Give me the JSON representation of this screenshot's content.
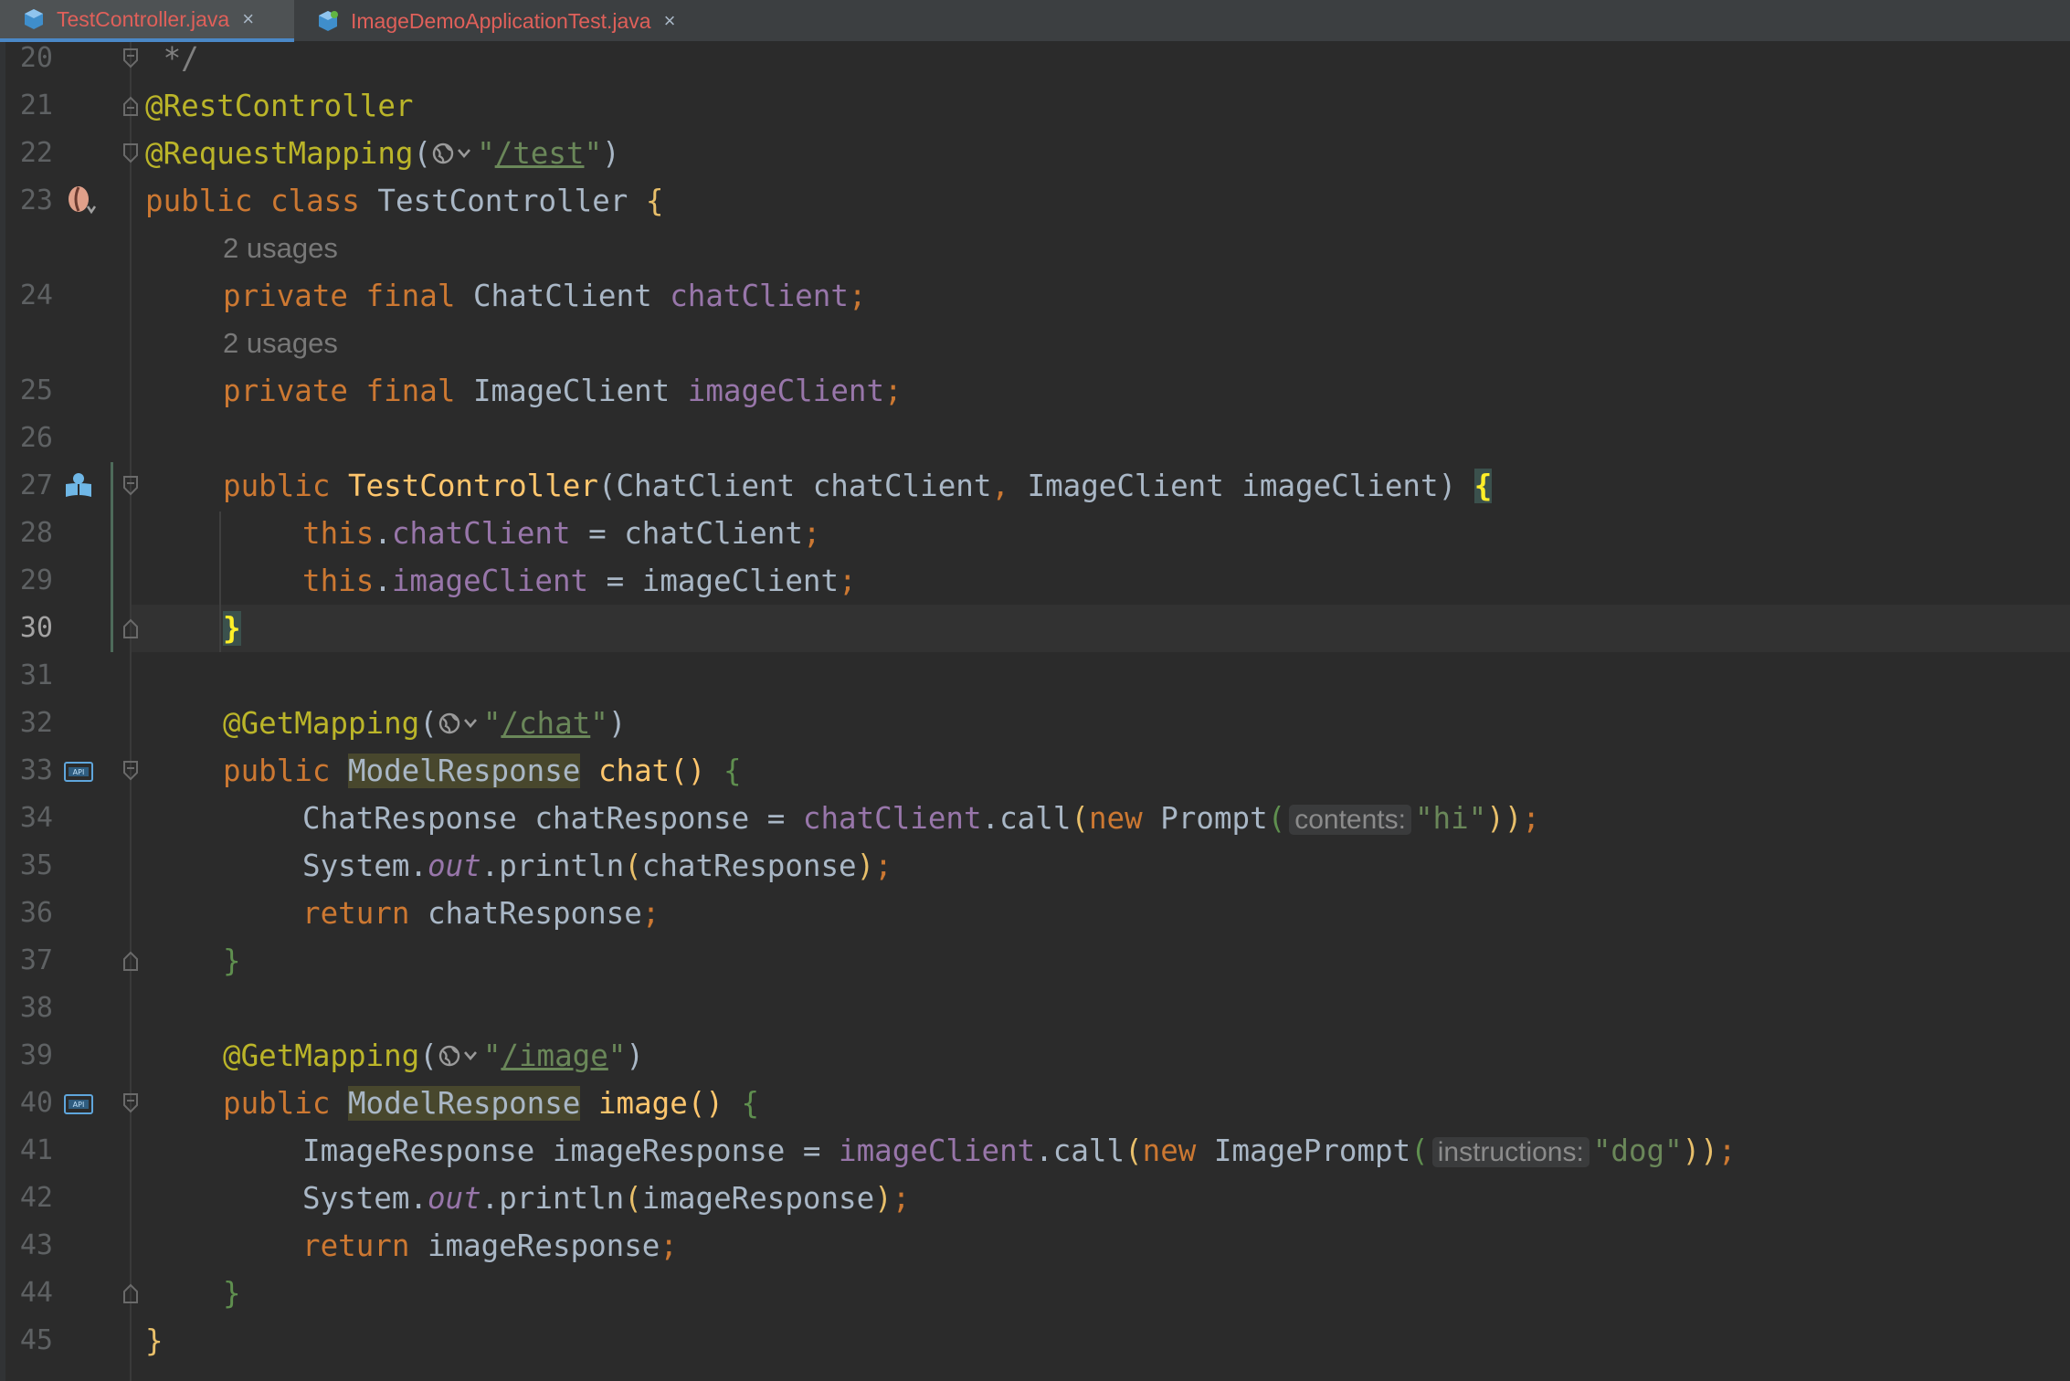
{
  "tabs": [
    {
      "label": "TestController.java",
      "active": true
    },
    {
      "label": "ImageDemoApplicationTest.java",
      "active": false
    }
  ],
  "tab_close_glyph": "×",
  "colors": {
    "background": "#2b2b2b",
    "keyword": "#cc7832",
    "annotation": "#bbb529",
    "field": "#9876aa",
    "string": "#6a8759",
    "method": "#ffc66d",
    "tab_text": "#e0605a"
  },
  "current_line": "30",
  "editor": {
    "l20": {
      "num": "20",
      "c": " */"
    },
    "l21": {
      "num": "21",
      "ann": "@RestController"
    },
    "l22": {
      "num": "22",
      "ann": "@RequestMapping",
      "p1": "(",
      "q": "\"",
      "url": "/test",
      "p2": ")"
    },
    "l23": {
      "num": "23",
      "k1": "public",
      "k2": "class",
      "name": "TestController",
      "b": "{"
    },
    "h1": "2 usages",
    "l24": {
      "num": "24",
      "k1": "private",
      "k2": "final",
      "type": "ChatClient",
      "f": "chatClient",
      "s": ";"
    },
    "h2": "2 usages",
    "l25": {
      "num": "25",
      "k1": "private",
      "k2": "final",
      "type": "ImageClient",
      "f": "imageClient",
      "s": ";"
    },
    "l26": {
      "num": "26"
    },
    "l27": {
      "num": "27",
      "k1": "public",
      "m": "TestController",
      "a": "(ChatClient chatClient",
      "comma": ",",
      "b": " ImageClient imageClient)",
      "br": "{"
    },
    "l28": {
      "num": "28",
      "k": "this",
      "dot": ".",
      "f": "chatClient",
      "rest": " = chatClient",
      "s": ";"
    },
    "l29": {
      "num": "29",
      "k": "this",
      "dot": ".",
      "f": "imageClient",
      "rest": " = imageClient",
      "s": ";"
    },
    "l30": {
      "num": "30",
      "br": "}"
    },
    "l31": {
      "num": "31"
    },
    "l32": {
      "num": "32",
      "ann": "@GetMapping",
      "p1": "(",
      "q": "\"",
      "url": "/chat",
      "p2": ")"
    },
    "l33": {
      "num": "33",
      "k1": "public",
      "t": "ModelResponse",
      "m": "chat",
      "paren": "()",
      "br": "{"
    },
    "l34": {
      "num": "34",
      "a": "ChatResponse chatResponse = ",
      "f": "chatClient",
      "b": ".call",
      "p": "(",
      "k": "new",
      "c": " Prompt",
      "p2": "(",
      "hint": "contents:",
      "str": "\"hi\"",
      "end": "))",
      "s": ";"
    },
    "l35": {
      "num": "35",
      "a": "System.",
      "out": "out",
      "b": ".println",
      "p": "(",
      "c": "chatResponse",
      "p2": ")",
      "s": ";"
    },
    "l36": {
      "num": "36",
      "k": "return",
      "c": " chatResponse",
      "s": ";"
    },
    "l37": {
      "num": "37",
      "br": "}"
    },
    "l38": {
      "num": "38"
    },
    "l39": {
      "num": "39",
      "ann": "@GetMapping",
      "p1": "(",
      "q": "\"",
      "url": "/image",
      "p2": ")"
    },
    "l40": {
      "num": "40",
      "k1": "public",
      "t": "ModelResponse",
      "m": "image",
      "paren": "()",
      "br": "{"
    },
    "l41": {
      "num": "41",
      "a": "ImageResponse imageResponse = ",
      "f": "imageClient",
      "b": ".call",
      "p": "(",
      "k": "new",
      "c": " ImagePrompt",
      "p2": "(",
      "hint": "instructions:",
      "str": "\"dog\"",
      "end": "))",
      "s": ";"
    },
    "l42": {
      "num": "42",
      "a": "System.",
      "out": "out",
      "b": ".println",
      "p": "(",
      "c": "imageResponse",
      "p2": ")",
      "s": ";"
    },
    "l43": {
      "num": "43",
      "k": "return",
      "c": " imageResponse",
      "s": ";"
    },
    "l44": {
      "num": "44",
      "br": "}"
    },
    "l45": {
      "num": "45",
      "br": "}"
    }
  },
  "icons": {
    "tab_file": "java-class-icon",
    "globe": "web-globe-icon",
    "bean": "spring-bean-icon",
    "api": "api-endpoint-icon",
    "fold": "fold-marker-icon"
  }
}
